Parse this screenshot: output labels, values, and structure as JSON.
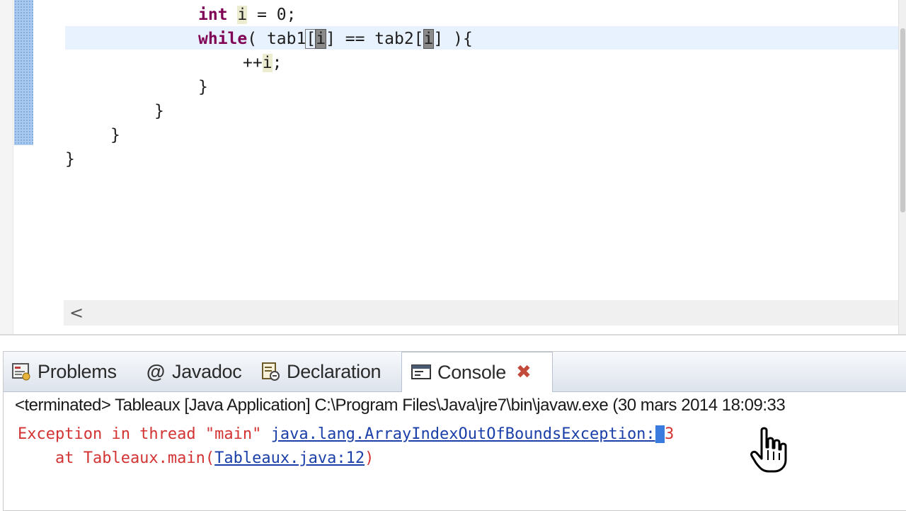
{
  "editor": {
    "lines": [
      {
        "indent": "        ",
        "parts": [
          [
            "kw",
            "int"
          ],
          [
            "t",
            " "
          ],
          [
            "var",
            "i"
          ],
          [
            "t",
            " = 0;"
          ]
        ]
      },
      {
        "indent": "        ",
        "parts": [
          [
            "kw",
            "while"
          ],
          [
            "t",
            "( tab1"
          ],
          [
            "bb",
            "["
          ],
          [
            "vb",
            "i"
          ],
          [
            "t",
            "] == tab2["
          ],
          [
            "vb",
            "i"
          ],
          [
            "t",
            "] ){"
          ]
        ]
      },
      {
        "indent": "            ",
        "parts": [
          [
            "t",
            "++"
          ],
          [
            "var",
            "i"
          ],
          [
            "t",
            ";"
          ]
        ]
      },
      {
        "indent": "        ",
        "parts": [
          [
            "t",
            "}"
          ]
        ]
      },
      {
        "indent": "    ",
        "parts": [
          [
            "t",
            "}"
          ]
        ]
      },
      {
        "indent": "",
        "parts": [
          [
            "t",
            "}"
          ]
        ]
      },
      {
        "indent": "",
        "parts": [
          [
            "t",
            "}"
          ]
        ]
      }
    ],
    "hscroll_left_glyph": "<"
  },
  "console_view": {
    "tabs": [
      {
        "id": "problems",
        "label": "Problems",
        "icon": "problems-icon"
      },
      {
        "id": "javadoc",
        "label": "Javadoc",
        "icon": "at-icon"
      },
      {
        "id": "declaration",
        "label": "Declaration",
        "icon": "declaration-icon"
      },
      {
        "id": "console",
        "label": "Console",
        "icon": "console-icon",
        "active": true
      }
    ],
    "close_glyph": "✖",
    "status": "<terminated> Tableaux [Java Application] C:\\Program Files\\Java\\jre7\\bin\\javaw.exe (30 mars 2014 18:09:33",
    "output": {
      "exception_prefix": "Exception in thread \"main\" ",
      "exception_class": "java.lang.ArrayIndexOutOfBoundsException:",
      "exception_value": "3",
      "at_prefix": "    at Tableaux.main(",
      "at_link": "Tableaux.java:12",
      "at_suffix": ")"
    }
  },
  "colors": {
    "keyword": "#7f0055",
    "error": "#d33333",
    "link": "#1b3fa8",
    "current_line": "#e8f2fe"
  }
}
